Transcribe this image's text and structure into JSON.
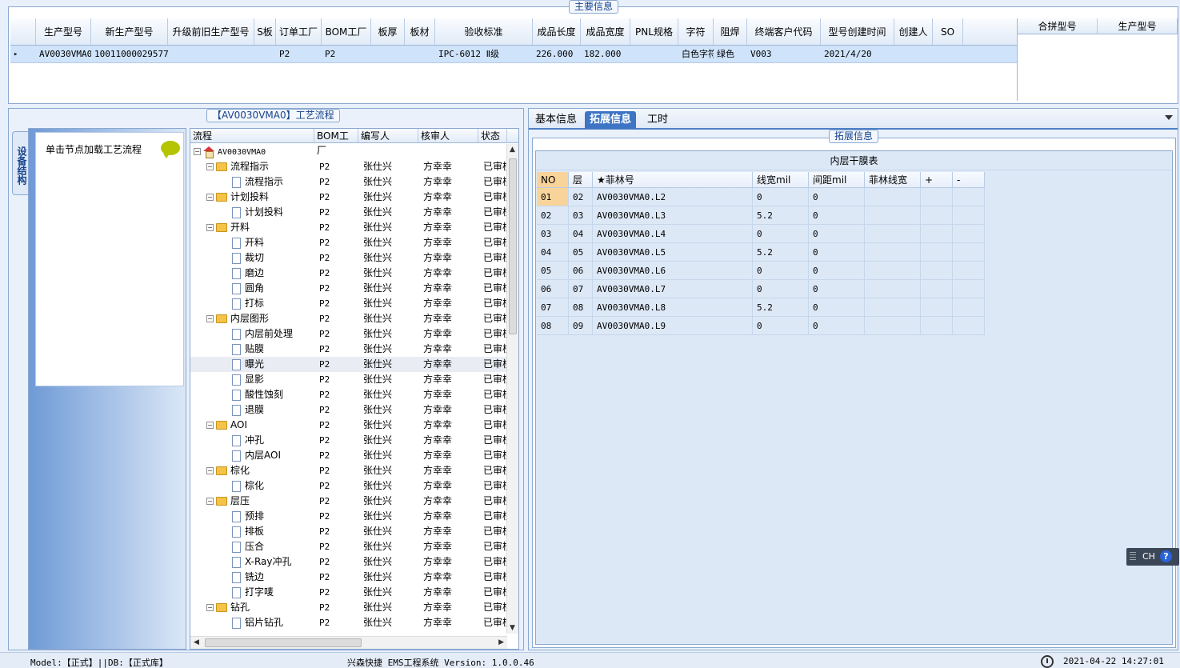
{
  "main_info": {
    "title": "主要信息",
    "columns": [
      "生产型号",
      "新生产型号",
      "升级前旧生产型号",
      "S板",
      "订单工厂",
      "BOM工厂",
      "板厚",
      "板材",
      "验收标准",
      "成品长度",
      "成品宽度",
      "PNL规格",
      "字符",
      "阻焊",
      "终端客户代码",
      "型号创建时间",
      "创建人",
      "SO"
    ],
    "row": [
      "AV0030VMA0",
      "10011000029577",
      "",
      "",
      "P2",
      "P2",
      "",
      "",
      "IPC-6012 Ⅱ级",
      "226.000",
      "182.000",
      "",
      "白色字符",
      "绿色",
      "V003",
      "2021/4/20",
      "",
      ""
    ],
    "row_indicator": "▸"
  },
  "merge_grid": {
    "columns": [
      "合拼型号",
      "生产型号"
    ]
  },
  "process_flow": {
    "title": "【AV0030VMA0】工艺流程",
    "vertical_tab": "设备结构",
    "equipment_hint": "单击节点加载工艺流程",
    "tree_columns": [
      "流程",
      "BOM工厂",
      "编写人",
      "核审人",
      "状态"
    ],
    "tree_rows": [
      {
        "name": "AV0030VMA0",
        "level": 0,
        "type": "root",
        "bom": "",
        "writer": "",
        "reviewer": "",
        "status": ""
      },
      {
        "name": "流程指示",
        "level": 1,
        "type": "folder",
        "bom": "P2",
        "writer": "张仕兴",
        "reviewer": "方幸幸",
        "status": "已审核"
      },
      {
        "name": "流程指示",
        "level": 2,
        "type": "page",
        "bom": "P2",
        "writer": "张仕兴",
        "reviewer": "方幸幸",
        "status": "已审核"
      },
      {
        "name": "计划投料",
        "level": 1,
        "type": "folder",
        "bom": "P2",
        "writer": "张仕兴",
        "reviewer": "方幸幸",
        "status": "已审核"
      },
      {
        "name": "计划投料",
        "level": 2,
        "type": "page",
        "bom": "P2",
        "writer": "张仕兴",
        "reviewer": "方幸幸",
        "status": "已审核"
      },
      {
        "name": "开料",
        "level": 1,
        "type": "folder",
        "bom": "P2",
        "writer": "张仕兴",
        "reviewer": "方幸幸",
        "status": "已审核"
      },
      {
        "name": "开料",
        "level": 2,
        "type": "page",
        "bom": "P2",
        "writer": "张仕兴",
        "reviewer": "方幸幸",
        "status": "已审核"
      },
      {
        "name": "裁切",
        "level": 2,
        "type": "page",
        "bom": "P2",
        "writer": "张仕兴",
        "reviewer": "方幸幸",
        "status": "已审核"
      },
      {
        "name": "磨边",
        "level": 2,
        "type": "page",
        "bom": "P2",
        "writer": "张仕兴",
        "reviewer": "方幸幸",
        "status": "已审核"
      },
      {
        "name": "圆角",
        "level": 2,
        "type": "page",
        "bom": "P2",
        "writer": "张仕兴",
        "reviewer": "方幸幸",
        "status": "已审核"
      },
      {
        "name": "打标",
        "level": 2,
        "type": "page",
        "bom": "P2",
        "writer": "张仕兴",
        "reviewer": "方幸幸",
        "status": "已审核"
      },
      {
        "name": "内层图形",
        "level": 1,
        "type": "folder",
        "bom": "P2",
        "writer": "张仕兴",
        "reviewer": "方幸幸",
        "status": "已审核"
      },
      {
        "name": "内层前处理",
        "level": 2,
        "type": "page",
        "bom": "P2",
        "writer": "张仕兴",
        "reviewer": "方幸幸",
        "status": "已审核"
      },
      {
        "name": "贴膜",
        "level": 2,
        "type": "page",
        "bom": "P2",
        "writer": "张仕兴",
        "reviewer": "方幸幸",
        "status": "已审核"
      },
      {
        "name": "曝光",
        "level": 2,
        "type": "page",
        "bom": "P2",
        "writer": "张仕兴",
        "reviewer": "方幸幸",
        "status": "已审核",
        "selected": true
      },
      {
        "name": "显影",
        "level": 2,
        "type": "page",
        "bom": "P2",
        "writer": "张仕兴",
        "reviewer": "方幸幸",
        "status": "已审核"
      },
      {
        "name": "酸性蚀刻",
        "level": 2,
        "type": "page",
        "bom": "P2",
        "writer": "张仕兴",
        "reviewer": "方幸幸",
        "status": "已审核"
      },
      {
        "name": "退膜",
        "level": 2,
        "type": "page",
        "bom": "P2",
        "writer": "张仕兴",
        "reviewer": "方幸幸",
        "status": "已审核"
      },
      {
        "name": "AOI",
        "level": 1,
        "type": "folder",
        "bom": "P2",
        "writer": "张仕兴",
        "reviewer": "方幸幸",
        "status": "已审核"
      },
      {
        "name": "冲孔",
        "level": 2,
        "type": "page",
        "bom": "P2",
        "writer": "张仕兴",
        "reviewer": "方幸幸",
        "status": "已审核"
      },
      {
        "name": "内层AOI",
        "level": 2,
        "type": "page",
        "bom": "P2",
        "writer": "张仕兴",
        "reviewer": "方幸幸",
        "status": "已审核"
      },
      {
        "name": "棕化",
        "level": 1,
        "type": "folder",
        "bom": "P2",
        "writer": "张仕兴",
        "reviewer": "方幸幸",
        "status": "已审核"
      },
      {
        "name": "棕化",
        "level": 2,
        "type": "page",
        "bom": "P2",
        "writer": "张仕兴",
        "reviewer": "方幸幸",
        "status": "已审核"
      },
      {
        "name": "层压",
        "level": 1,
        "type": "folder",
        "bom": "P2",
        "writer": "张仕兴",
        "reviewer": "方幸幸",
        "status": "已审核"
      },
      {
        "name": "预排",
        "level": 2,
        "type": "page",
        "bom": "P2",
        "writer": "张仕兴",
        "reviewer": "方幸幸",
        "status": "已审核"
      },
      {
        "name": "排板",
        "level": 2,
        "type": "page",
        "bom": "P2",
        "writer": "张仕兴",
        "reviewer": "方幸幸",
        "status": "已审核"
      },
      {
        "name": "压合",
        "level": 2,
        "type": "page",
        "bom": "P2",
        "writer": "张仕兴",
        "reviewer": "方幸幸",
        "status": "已审核"
      },
      {
        "name": "X-Ray冲孔",
        "level": 2,
        "type": "page",
        "bom": "P2",
        "writer": "张仕兴",
        "reviewer": "方幸幸",
        "status": "已审核"
      },
      {
        "name": "铣边",
        "level": 2,
        "type": "page",
        "bom": "P2",
        "writer": "张仕兴",
        "reviewer": "方幸幸",
        "status": "已审核"
      },
      {
        "name": "打字唛",
        "level": 2,
        "type": "page",
        "bom": "P2",
        "writer": "张仕兴",
        "reviewer": "方幸幸",
        "status": "已审核"
      },
      {
        "name": "钻孔",
        "level": 1,
        "type": "folder",
        "bom": "P2",
        "writer": "张仕兴",
        "reviewer": "方幸幸",
        "status": "已审核"
      },
      {
        "name": "铝片钻孔",
        "level": 2,
        "type": "page",
        "bom": "P2",
        "writer": "张仕兴",
        "reviewer": "方幸幸",
        "status": "已审核"
      }
    ]
  },
  "tabs": {
    "items": [
      "基本信息",
      "拓展信息",
      "工时"
    ],
    "active": "拓展信息"
  },
  "extension": {
    "title": "拓展信息",
    "table_title": "内层干膜表",
    "columns": [
      "NO",
      "层",
      "★菲林号",
      "线宽mil",
      "间距mil",
      "菲林线宽",
      "+",
      "-"
    ],
    "rows": [
      [
        "01",
        "02",
        "AV0030VMA0.L2",
        "0",
        "0",
        "",
        "",
        ""
      ],
      [
        "02",
        "03",
        "AV0030VMA0.L3",
        "5.2",
        "0",
        "",
        "",
        ""
      ],
      [
        "03",
        "04",
        "AV0030VMA0.L4",
        "0",
        "0",
        "",
        "",
        ""
      ],
      [
        "04",
        "05",
        "AV0030VMA0.L5",
        "5.2",
        "0",
        "",
        "",
        ""
      ],
      [
        "05",
        "06",
        "AV0030VMA0.L6",
        "0",
        "0",
        "",
        "",
        ""
      ],
      [
        "06",
        "07",
        "AV0030VMA0.L7",
        "0",
        "0",
        "",
        "",
        ""
      ],
      [
        "07",
        "08",
        "AV0030VMA0.L8",
        "5.2",
        "0",
        "",
        "",
        ""
      ],
      [
        "08",
        "09",
        "AV0030VMA0.L9",
        "0",
        "0",
        "",
        "",
        ""
      ]
    ]
  },
  "ime": {
    "label": "CH",
    "help": "?"
  },
  "status": {
    "left": "Model:【正式】||DB:【正式库】",
    "middle": "兴森快捷 EMS工程系统 Version: 1.0.0.46",
    "time": "2021-04-22 14:27:01"
  }
}
